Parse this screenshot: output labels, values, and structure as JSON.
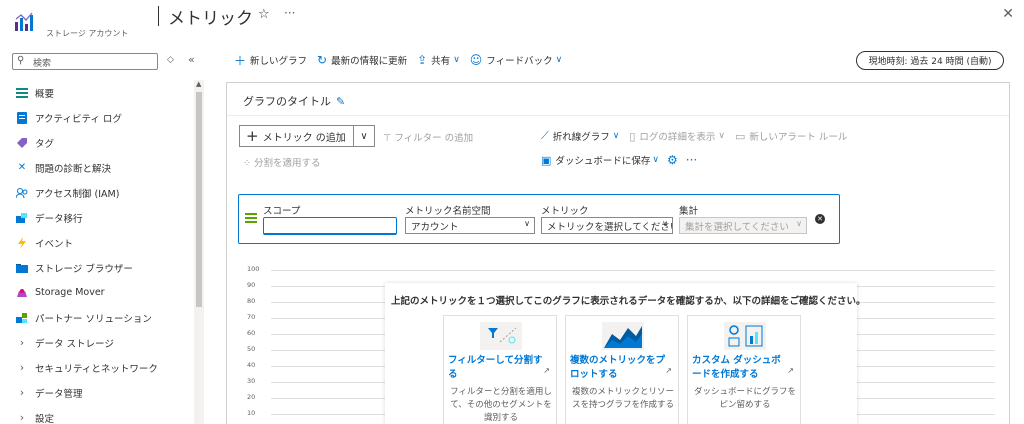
{
  "app": {
    "subtitle": "ストレージ アカウント",
    "title": "メトリック"
  },
  "sidebar": {
    "search_placeholder": "検索",
    "items": [
      {
        "label": "概要",
        "icon": "overview-icon",
        "color": "#0e8a7e"
      },
      {
        "label": "アクティビティ ログ",
        "icon": "activity-log-icon",
        "color": "#0078d4"
      },
      {
        "label": "タグ",
        "icon": "tag-icon",
        "color": "#8661c5"
      },
      {
        "label": "問題の診断と解決",
        "icon": "wrench-icon",
        "color": "#0078d4"
      },
      {
        "label": "アクセス制御 (IAM)",
        "icon": "people-icon",
        "color": "#0078d4"
      },
      {
        "label": "データ移行",
        "icon": "migration-icon",
        "color": "#0078d4"
      },
      {
        "label": "イベント",
        "icon": "lightning-icon",
        "color": "#ffb900"
      },
      {
        "label": "ストレージ ブラウザー",
        "icon": "folder-icon",
        "color": "#0078d4"
      },
      {
        "label": "Storage Mover",
        "icon": "storage-mover-icon",
        "color": "#b146c2"
      },
      {
        "label": "パートナー ソリューション",
        "icon": "partner-icon",
        "color": "#0078d4"
      }
    ],
    "groups": [
      {
        "label": "データ ストレージ"
      },
      {
        "label": "セキュリティとネットワーク"
      },
      {
        "label": "データ管理"
      },
      {
        "label": "設定"
      }
    ]
  },
  "toolbar": {
    "new_chart": "新しいグラフ",
    "refresh": "最新の情報に更新",
    "share": "共有",
    "feedback": "フィードバック",
    "time_range": "現地時刻: 過去 24 時間 (自動)"
  },
  "chart_panel": {
    "title": "グラフのタイトル",
    "add_metric": "メトリック の追加",
    "add_filter": "フィルター の追加",
    "apply_split": "分割を適用する",
    "line_chart": "折れ線グラフ",
    "show_log_details": "ログの詳細を表示",
    "new_alert_rule": "新しいアラート ルール",
    "save_to_dashboard": "ダッシュボードに保存"
  },
  "selector": {
    "scope_label": "スコープ",
    "scope_value": "",
    "namespace_label": "メトリック名前空間",
    "namespace_value": "アカウント",
    "metric_label": "メトリック",
    "metric_value": "メトリックを選択してください",
    "aggregation_label": "集計",
    "aggregation_value": "集計を選択してください"
  },
  "empty_chart": {
    "y_ticks": [
      "100",
      "90",
      "80",
      "70",
      "60",
      "50",
      "40",
      "30",
      "20",
      "10"
    ]
  },
  "info": {
    "heading": "上記のメトリックを１つ選択してこのグラフに表示されるデータを確認するか、以下の詳細をご確認ください。",
    "cards": [
      {
        "title": "フィルターして分割する",
        "desc": "フィルターと分割を適用して、その他のセグメントを識別する",
        "icon": "filter-split-icon"
      },
      {
        "title": "複数のメトリックをプロットする",
        "desc": "複数のメトリックとリソースを持つグラフを作成する",
        "icon": "multi-metric-icon"
      },
      {
        "title": "カスタム ダッシュボードを作成する",
        "desc": "ダッシュボードにグラフをピン留めする",
        "icon": "dashboard-icon"
      }
    ]
  }
}
